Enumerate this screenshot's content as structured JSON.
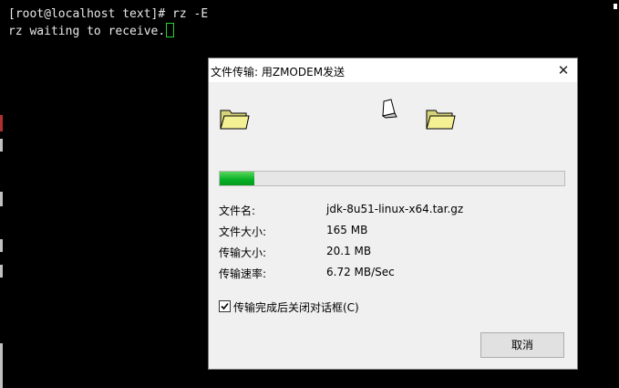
{
  "terminal": {
    "line1": "[root@localhost text]# rz -E",
    "line2": "rz waiting to receive."
  },
  "dialog": {
    "title": "文件传输: 用ZMODEM发送",
    "close_glyph": "✕",
    "progress_fraction": 0.1,
    "fields": {
      "filename_label": "文件名:",
      "filename_value": "jdk-8u51-linux-x64.tar.gz",
      "filesize_label": "文件大小:",
      "filesize_value": "165 MB",
      "transferred_label": "传输大小:",
      "transferred_value": "20.1 MB",
      "speed_label": "传输速率:",
      "speed_value": "6.72 MB/Sec"
    },
    "auto_close_label": "传输完成后关闭对话框(C)",
    "auto_close_checked": true,
    "cancel_label": "取消"
  },
  "icons": {
    "source": "folder-icon",
    "flying": "paper-icon",
    "target": "folder-icon"
  },
  "colors": {
    "terminal_bg": "#000000",
    "terminal_fg": "#e8e8e8",
    "progress": "#06b025",
    "cursor": "#2ad12a"
  }
}
